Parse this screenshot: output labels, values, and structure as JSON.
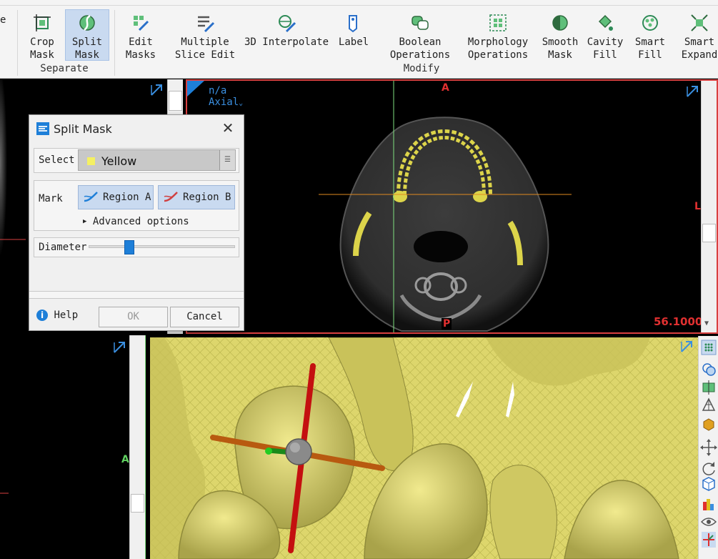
{
  "ribbon": {
    "buttons": {
      "crop_mask": "Crop\nMask",
      "split_mask": "Split\nMask",
      "edit_masks": "Edit\nMasks",
      "multiple_slice_edit": "Multiple\nSlice Edit",
      "interpolate_3d": "3D Interpolate",
      "label": "Label",
      "boolean_operations": "Boolean\nOperations",
      "morphology_operations": "Morphology\nOperations",
      "smooth_mask": "Smooth\nMask",
      "cavity_fill": "Cavity\nFill",
      "smart_fill": "Smart\nFill",
      "smart_expand": "Smart\nExpand"
    },
    "groups": {
      "separate": "Separate",
      "modify": "Modify"
    },
    "left_edge_text": "e"
  },
  "axial": {
    "overlay_top": "n/a",
    "overlay_view": "Axial",
    "orient_top": "A",
    "orient_right": "L",
    "orient_bottom": "P",
    "slice_value": "56.1000"
  },
  "bottom_left": {
    "orient_label": "A"
  },
  "dialog": {
    "title": "Split Mask",
    "select_label": "Select",
    "select_value": "Yellow",
    "select_color": "#f4f062",
    "mark_label": "Mark",
    "region_a": "Region A",
    "region_b": "Region B",
    "advanced_options": "Advanced options",
    "diameter_label": "Diameter",
    "diameter_level": 0.28,
    "help": "Help",
    "ok": "OK",
    "cancel": "Cancel"
  },
  "colors": {
    "accent_blue": "#1e7fd8",
    "active_viewport_border": "#d94040",
    "mask_yellow": "#e3dc74"
  }
}
